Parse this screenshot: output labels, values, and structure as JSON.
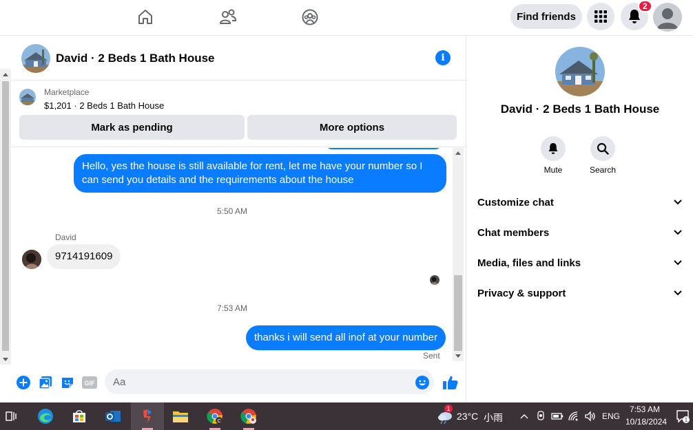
{
  "topnav": {
    "find_friends_label": "Find friends",
    "notification_count": "2"
  },
  "chat": {
    "title": "David · 2 Beds 1 Bath House"
  },
  "marketplace": {
    "label": "Marketplace",
    "item": "$1,201 · 2 Beds 1 Bath House",
    "mark_pending_label": "Mark as pending",
    "more_options_label": "More options"
  },
  "messages": {
    "out1": "Hello, yes the house is still available for rent, let me have your number so I can send you details and the requirements about the house",
    "time1": "5:50 AM",
    "sender_name": "David",
    "in1": "9714191609",
    "time2": "7:53 AM",
    "out2": "thanks i will send all inof at your number",
    "status": "Sent"
  },
  "composer": {
    "placeholder": "Aa"
  },
  "right_panel": {
    "title": "David · 2 Beds 1 Bath House",
    "mute_label": "Mute",
    "search_label": "Search",
    "rows": [
      "Customize chat",
      "Chat members",
      "Media, files and links",
      "Privacy & support"
    ]
  },
  "taskbar": {
    "weather_temp": "23°C",
    "weather_desc": "小雨",
    "weather_badge": "1",
    "lang": "ENG",
    "time": "7:53 AM",
    "date": "10/18/2024",
    "notif_count": "1"
  },
  "colors": {
    "accent": "#0a7cff",
    "badge": "#e41e3f",
    "taskbar": "#3b3238"
  }
}
